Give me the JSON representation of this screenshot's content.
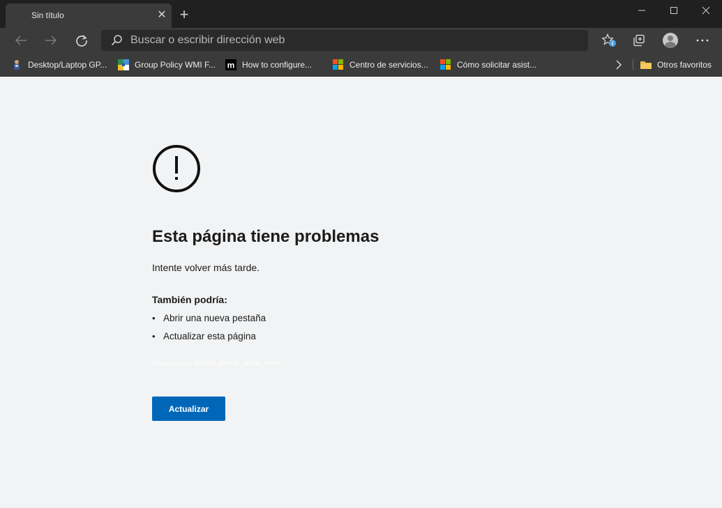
{
  "tab": {
    "title": "Sin título"
  },
  "address": {
    "placeholder": "Buscar o escribir dirección web"
  },
  "favorites": [
    {
      "label": "Desktop/Laptop GP...",
      "icon": "person-icon"
    },
    {
      "label": "Group Policy WMI F...",
      "icon": "puzzle-icon"
    },
    {
      "label": "How to configure...",
      "icon": "m-logo-icon"
    },
    {
      "label": "Centro de servicios...",
      "icon": "microsoft-logo-icon"
    },
    {
      "label": "Cómo solicitar asist...",
      "icon": "microsoft-logo-icon"
    }
  ],
  "favorites_other": {
    "label": "Otros favoritos",
    "icon": "folder-icon"
  },
  "error": {
    "title": "Esta página tiene problemas",
    "subtitle": "Intente volver más tarde.",
    "also_heading": "También podría:",
    "suggestions": [
      "Abrir una nueva pestaña",
      "Actualizar esta página"
    ],
    "code": "Código de error: STATUS_INVALID_IMAGE_HASH",
    "button": "Actualizar"
  },
  "colors": {
    "accent": "#0067b8",
    "chrome_dark": "#202020",
    "chrome_mid": "#3b3b3b",
    "page_bg": "#f2f3f4"
  }
}
